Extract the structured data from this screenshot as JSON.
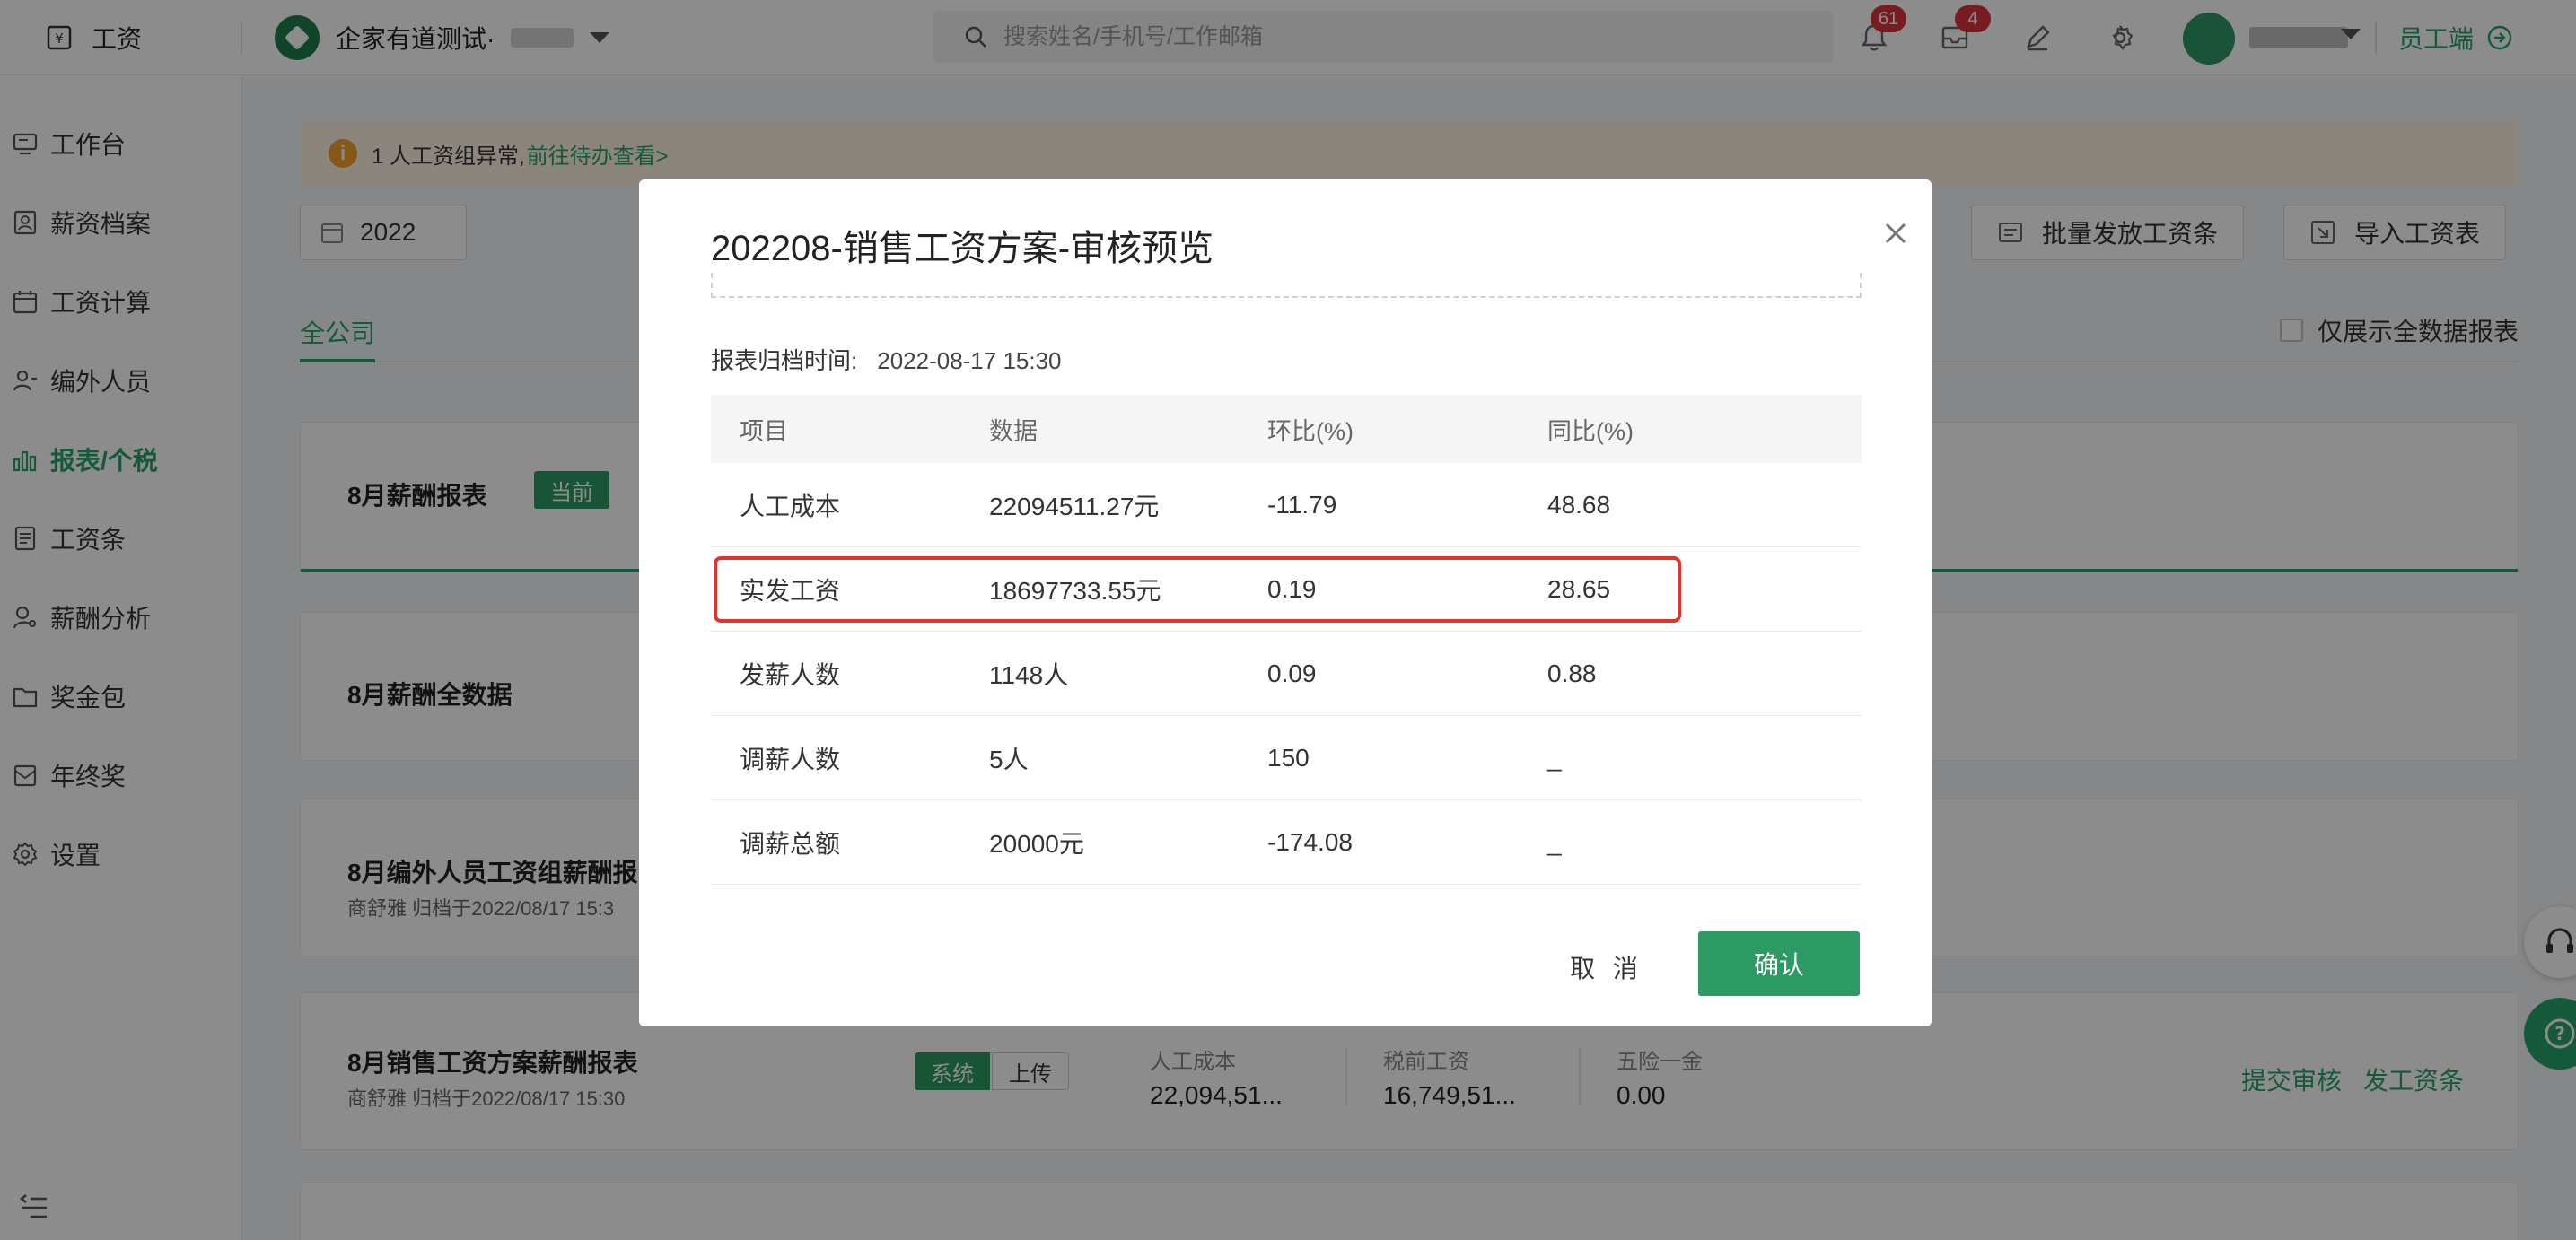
{
  "topbar": {
    "app_name": "工资",
    "company_name": "企家有道测试·",
    "search_placeholder": "搜索姓名/手机号/工作邮箱",
    "notification_count": "61",
    "message_count": "4",
    "staff_link": "员工端"
  },
  "sidebar": {
    "items": [
      {
        "label": "工作台",
        "icon": "monitor-icon"
      },
      {
        "label": "薪资档案",
        "icon": "profile-icon"
      },
      {
        "label": "工资计算",
        "icon": "calendar-icon"
      },
      {
        "label": "编外人员",
        "icon": "users-icon"
      },
      {
        "label": "报表/个税",
        "icon": "chart-icon"
      },
      {
        "label": "工资条",
        "icon": "document-icon"
      },
      {
        "label": "薪酬分析",
        "icon": "user-search-icon"
      },
      {
        "label": "奖金包",
        "icon": "folder-icon"
      },
      {
        "label": "年终奖",
        "icon": "gift-icon"
      },
      {
        "label": "设置",
        "icon": "gear-icon"
      }
    ],
    "active_index": 4
  },
  "main": {
    "alert_text": "1 人工资组异常,",
    "alert_link": "前往待办查看>",
    "year": "2022",
    "batch_button": "批量发放工资条",
    "import_button": "导入工资表",
    "tab_all": "全公司",
    "checkbox_label": "仅展示全数据报表",
    "cards": [
      {
        "title": "8月薪酬报表",
        "tag": "当前"
      },
      {
        "title": "8月薪酬全数据"
      },
      {
        "title": "8月编外人员工资组薪酬报",
        "sub": "商舒雅 归档于2022/08/17 15:3"
      },
      {
        "title": "8月销售工资方案薪酬报表",
        "sub": "商舒雅 归档于2022/08/17 15:30",
        "tag_system": "系统",
        "tag_upload": "上传",
        "metrics": [
          {
            "label": "人工成本",
            "value": "22,094,51..."
          },
          {
            "label": "税前工资",
            "value": "16,749,51..."
          },
          {
            "label": "五险一金",
            "value": "0.00"
          }
        ],
        "action_submit": "提交审核",
        "action_pay": "发工资条"
      }
    ]
  },
  "modal": {
    "title": "202208-销售工资方案-审核预览",
    "archive_label": "报表归档时间:",
    "archive_time": "2022-08-17 15:30",
    "columns": [
      "项目",
      "数据",
      "环比(%)",
      "同比(%)"
    ],
    "rows": [
      [
        "人工成本",
        "22094511.27元",
        "-11.79",
        "48.68"
      ],
      [
        "实发工资",
        "18697733.55元",
        "0.19",
        "28.65"
      ],
      [
        "发薪人数",
        "1148人",
        "0.09",
        "0.88"
      ],
      [
        "调薪人数",
        "5人",
        "150",
        "_"
      ],
      [
        "调薪总额",
        "20000元",
        "-174.08",
        "_"
      ]
    ],
    "highlighted_row": 1,
    "cancel": "取 消",
    "confirm": "确认"
  },
  "colors": {
    "brand": "#25a26a",
    "button": "#2d9a63",
    "highlight": "#e0342b",
    "badge": "#d9363e"
  }
}
